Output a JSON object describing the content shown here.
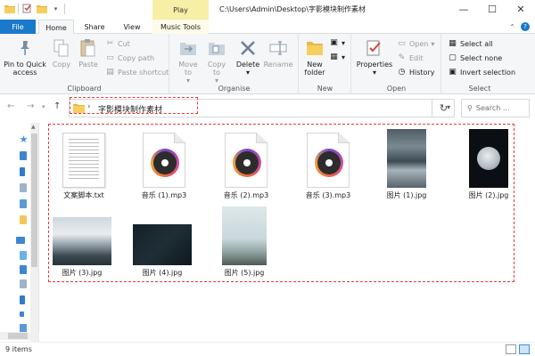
{
  "window": {
    "title": "C:\\Users\\Admin\\Desktop\\字影模块制作素材",
    "context_tab_header": "Play"
  },
  "tabs": {
    "file": "File",
    "home": "Home",
    "share": "Share",
    "view": "View",
    "music_tools": "Music Tools"
  },
  "ribbon": {
    "clipboard": {
      "label": "Clipboard",
      "pin": "Pin to Quick access",
      "copy": "Copy",
      "paste": "Paste",
      "cut": "Cut",
      "copy_path": "Copy path",
      "paste_shortcut": "Paste shortcut"
    },
    "organise": {
      "label": "Organise",
      "move_to": "Move to",
      "copy_to": "Copy to",
      "delete": "Delete",
      "rename": "Rename"
    },
    "new": {
      "label": "New",
      "new_folder": "New folder"
    },
    "open": {
      "label": "Open",
      "properties": "Properties",
      "open": "Open",
      "edit": "Edit",
      "history": "History"
    },
    "select": {
      "label": "Select",
      "select_all": "Select all",
      "select_none": "Select none",
      "invert_selection": "Invert selection"
    }
  },
  "address": {
    "path": "字影模块制作素材",
    "search_placeholder": "Search ..."
  },
  "files": [
    {
      "name": "文案脚本.txt",
      "type": "txt"
    },
    {
      "name": "音乐 (1).mp3",
      "type": "mp3"
    },
    {
      "name": "音乐 (2).mp3",
      "type": "mp3"
    },
    {
      "name": "音乐 (3).mp3",
      "type": "mp3"
    },
    {
      "name": "图片 (1).jpg",
      "type": "jpg"
    },
    {
      "name": "图片 (2).jpg",
      "type": "jpg"
    },
    {
      "name": "图片 (3).jpg",
      "type": "jpg"
    },
    {
      "name": "图片 (4).jpg",
      "type": "jpg"
    },
    {
      "name": "图片 (5).jpg",
      "type": "jpg"
    }
  ],
  "status": {
    "item_count": "9 items"
  },
  "colors": {
    "accent": "#1979ca",
    "context_tab": "#f7efa6",
    "highlight_box": "#e33b3b"
  }
}
